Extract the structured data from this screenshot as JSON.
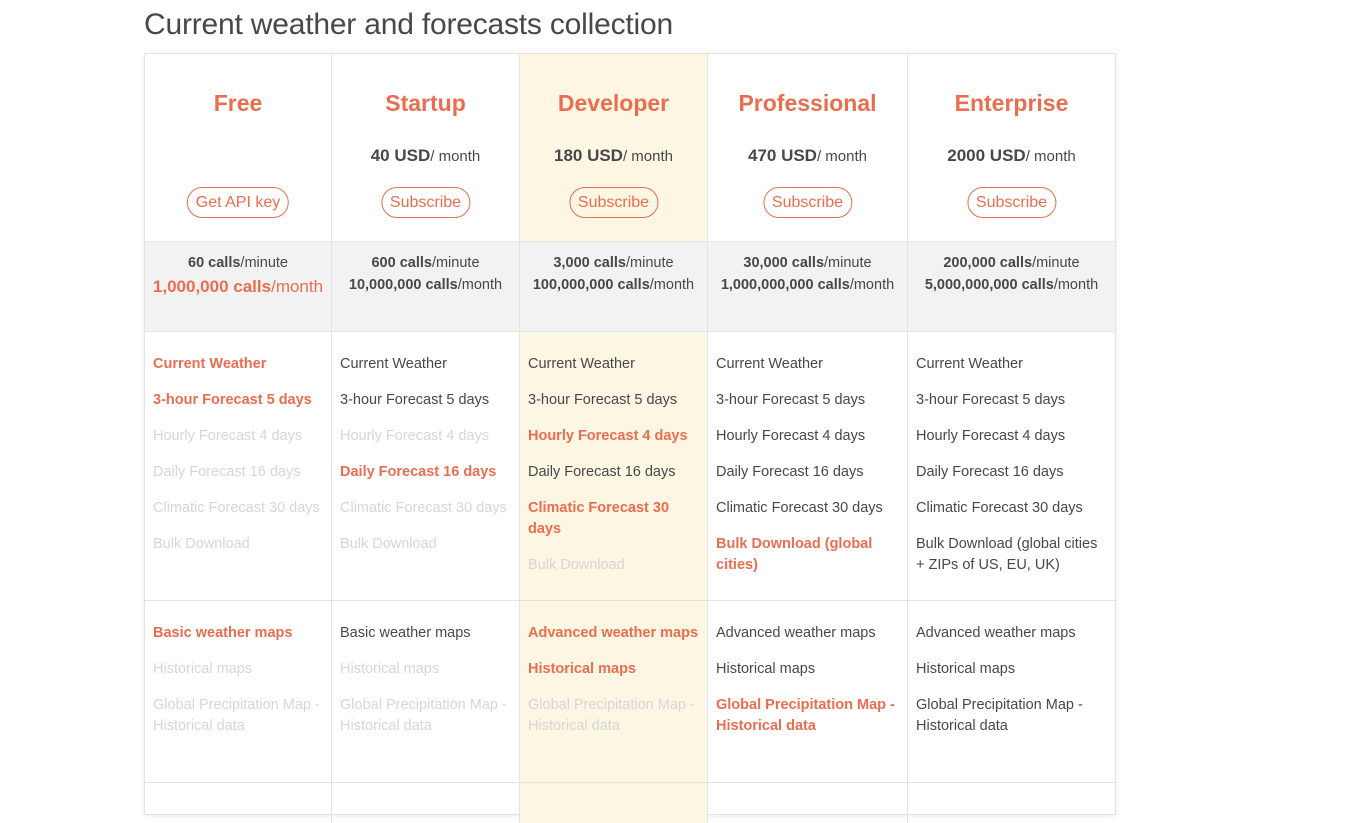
{
  "page_title": "Current weather and forecasts collection",
  "colors": {
    "accent": "#e96e50",
    "highlight": "#fdf6e2",
    "calls_bg": "#f2f2f2",
    "muted": "#d6d6d6",
    "text": "#48484a"
  },
  "plans": [
    {
      "name": "Free",
      "price": "",
      "price_unit": "",
      "button": "Get API key",
      "calls_minute": "60 calls",
      "calls_minute_unit": "/minute",
      "calls_month": "1,000,000 calls",
      "calls_month_unit": "/month",
      "features": [
        {
          "label": "Current Weather",
          "state": "on"
        },
        {
          "label": "3-hour Forecast 5 days",
          "state": "on"
        },
        {
          "label": "Hourly Forecast 4 days",
          "state": "off"
        },
        {
          "label": "Daily Forecast 16 days",
          "state": "off"
        },
        {
          "label": "Climatic Forecast 30 days",
          "state": "off"
        },
        {
          "label": "Bulk Download",
          "state": "off"
        }
      ],
      "maps": [
        {
          "label": "Basic weather maps",
          "state": "on"
        },
        {
          "label": "Historical maps",
          "state": "off"
        },
        {
          "label": "Global Precipitation Map - Historical data",
          "state": "off"
        }
      ]
    },
    {
      "name": "Startup",
      "price": "40 USD",
      "price_unit": "/ month",
      "button": "Subscribe",
      "calls_minute": "600 calls",
      "calls_minute_unit": "/minute",
      "calls_month": "10,000,000 calls",
      "calls_month_unit": "/month",
      "features": [
        {
          "label": "Current Weather",
          "state": "normal"
        },
        {
          "label": "3-hour Forecast 5 days",
          "state": "normal"
        },
        {
          "label": "Hourly Forecast 4 days",
          "state": "off"
        },
        {
          "label": "Daily Forecast 16 days",
          "state": "on"
        },
        {
          "label": "Climatic Forecast 30 days",
          "state": "off"
        },
        {
          "label": "Bulk Download",
          "state": "off"
        }
      ],
      "maps": [
        {
          "label": "Basic weather maps",
          "state": "normal"
        },
        {
          "label": "Historical maps",
          "state": "off"
        },
        {
          "label": "Global Precipitation Map - Historical data",
          "state": "off"
        }
      ]
    },
    {
      "name": "Developer",
      "price": "180 USD",
      "price_unit": "/ month",
      "button": "Subscribe",
      "calls_minute": "3,000 calls",
      "calls_minute_unit": "/minute",
      "calls_month": "100,000,000 calls",
      "calls_month_unit": "/month",
      "features": [
        {
          "label": "Current Weather",
          "state": "normal"
        },
        {
          "label": "3-hour Forecast 5 days",
          "state": "normal"
        },
        {
          "label": "Hourly Forecast 4 days",
          "state": "on"
        },
        {
          "label": "Daily Forecast 16 days",
          "state": "normal"
        },
        {
          "label": "Climatic Forecast 30 days",
          "state": "on"
        },
        {
          "label": "Bulk Download",
          "state": "off"
        }
      ],
      "maps": [
        {
          "label": "Advanced weather maps",
          "state": "on"
        },
        {
          "label": "Historical maps",
          "state": "on"
        },
        {
          "label": "Global Precipitation Map - Historical data",
          "state": "off"
        }
      ]
    },
    {
      "name": "Professional",
      "price": "470 USD",
      "price_unit": "/ month",
      "button": "Subscribe",
      "calls_minute": "30,000 calls",
      "calls_minute_unit": "/minute",
      "calls_month": "1,000,000,000 calls",
      "calls_month_unit": "/month",
      "features": [
        {
          "label": "Current Weather",
          "state": "normal"
        },
        {
          "label": "3-hour Forecast 5 days",
          "state": "normal"
        },
        {
          "label": "Hourly Forecast 4 days",
          "state": "normal"
        },
        {
          "label": "Daily Forecast 16 days",
          "state": "normal"
        },
        {
          "label": "Climatic Forecast 30 days",
          "state": "normal"
        },
        {
          "label": "Bulk Download (global cities)",
          "state": "on"
        }
      ],
      "maps": [
        {
          "label": "Advanced weather maps",
          "state": "normal"
        },
        {
          "label": "Historical maps",
          "state": "normal"
        },
        {
          "label": "Global Precipitation Map - Historical data",
          "state": "on"
        }
      ]
    },
    {
      "name": "Enterprise",
      "price": "2000 USD",
      "price_unit": "/ month",
      "button": "Subscribe",
      "calls_minute": "200,000 calls",
      "calls_minute_unit": "/minute",
      "calls_month": "5,000,000,000 calls",
      "calls_month_unit": "/month",
      "features": [
        {
          "label": "Current Weather",
          "state": "normal"
        },
        {
          "label": "3-hour Forecast 5 days",
          "state": "normal"
        },
        {
          "label": "Hourly Forecast 4 days",
          "state": "normal"
        },
        {
          "label": "Daily Forecast 16 days",
          "state": "normal"
        },
        {
          "label": "Climatic Forecast 30 days",
          "state": "normal"
        },
        {
          "label": "Bulk Download (global cities + ZIPs of US, EU, UK)",
          "state": "normal"
        }
      ],
      "maps": [
        {
          "label": "Advanced weather maps",
          "state": "normal"
        },
        {
          "label": "Historical maps",
          "state": "normal"
        },
        {
          "label": "Global Precipitation Map - Historical data",
          "state": "normal"
        }
      ]
    }
  ]
}
